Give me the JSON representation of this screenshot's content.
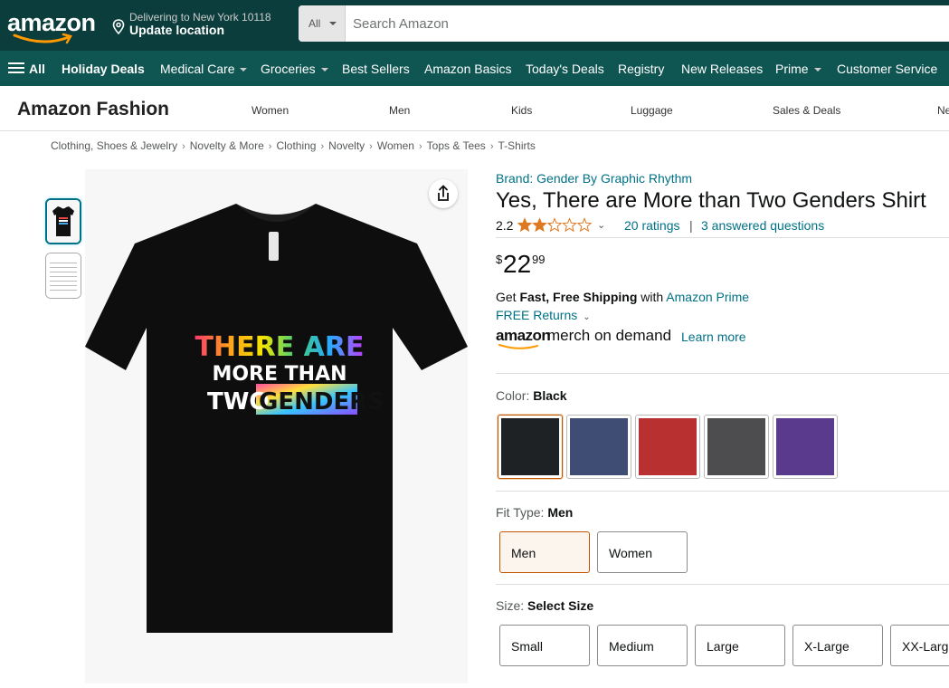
{
  "header": {
    "logo": "amazon",
    "location_line1": "Delivering to New York 10118",
    "location_line2": "Update location",
    "search_category": "All",
    "search_placeholder": "Search Amazon"
  },
  "nav": {
    "all_label": "All",
    "items": [
      {
        "label": "Holiday Deals",
        "bold": true
      },
      {
        "label": "Medical Care",
        "caret": true
      },
      {
        "label": "Groceries",
        "caret": true
      },
      {
        "label": "Best Sellers"
      },
      {
        "label": "Amazon Basics"
      },
      {
        "label": "Today's Deals"
      },
      {
        "label": "Registry"
      },
      {
        "label": "New Releases"
      },
      {
        "label": "Prime",
        "caret": true
      },
      {
        "label": "Customer Service"
      }
    ]
  },
  "subnav": {
    "title": "Amazon Fashion",
    "items": [
      "Women",
      "Men",
      "Kids",
      "Luggage",
      "Sales & Deals",
      "Ne"
    ]
  },
  "breadcrumb": [
    "Clothing, Shoes & Jewelry",
    "Novelty & More",
    "Clothing",
    "Novelty",
    "Women",
    "Tops & Tees",
    "T-Shirts"
  ],
  "product": {
    "brand": "Brand: Gender By Graphic Rhythm",
    "title": "Yes, There are More than Two Genders Shirt",
    "rating": "2.2",
    "rating_value": 2.2,
    "ratings_count": "20 ratings",
    "rating_divider": "|",
    "questions": "3 answered questions",
    "price_symbol": "$",
    "price_whole": "22",
    "price_fraction": "99",
    "shipping_prefix": "Get ",
    "shipping_bold": "Fast, Free Shipping",
    "shipping_mid": " with ",
    "shipping_link": "Amazon Prime",
    "returns": "FREE Returns",
    "merch_amazon": "amazon",
    "merch_rest": "merch on demand",
    "learn_more": "Learn more",
    "shirt_text": {
      "line1": "THERE ARE",
      "line2": "MORE THAN",
      "line3a": "TWO",
      "line3b": "GENDERS"
    }
  },
  "options": {
    "color_label": "Color: ",
    "color_value": "Black",
    "colors": [
      {
        "name": "Black",
        "hex": "#1f2225",
        "selected": true
      },
      {
        "name": "Navy",
        "hex": "#3f4d75"
      },
      {
        "name": "Red",
        "hex": "#b8302f"
      },
      {
        "name": "Heather Grey",
        "hex": "#4d4d4f"
      },
      {
        "name": "Purple",
        "hex": "#5a3a8c"
      }
    ],
    "fit_label": "Fit Type: ",
    "fit_value": "Men",
    "fits": [
      {
        "label": "Men",
        "selected": true
      },
      {
        "label": "Women"
      }
    ],
    "size_label": "Size: ",
    "size_value": "Select Size",
    "sizes": [
      "Small",
      "Medium",
      "Large",
      "X-Large",
      "XX-Large"
    ]
  },
  "colors": {
    "header_bg": "#0b3d3c",
    "nav_bg": "#0f5551",
    "link": "#007185",
    "star": "#de7921",
    "selected_border": "#c45500"
  }
}
